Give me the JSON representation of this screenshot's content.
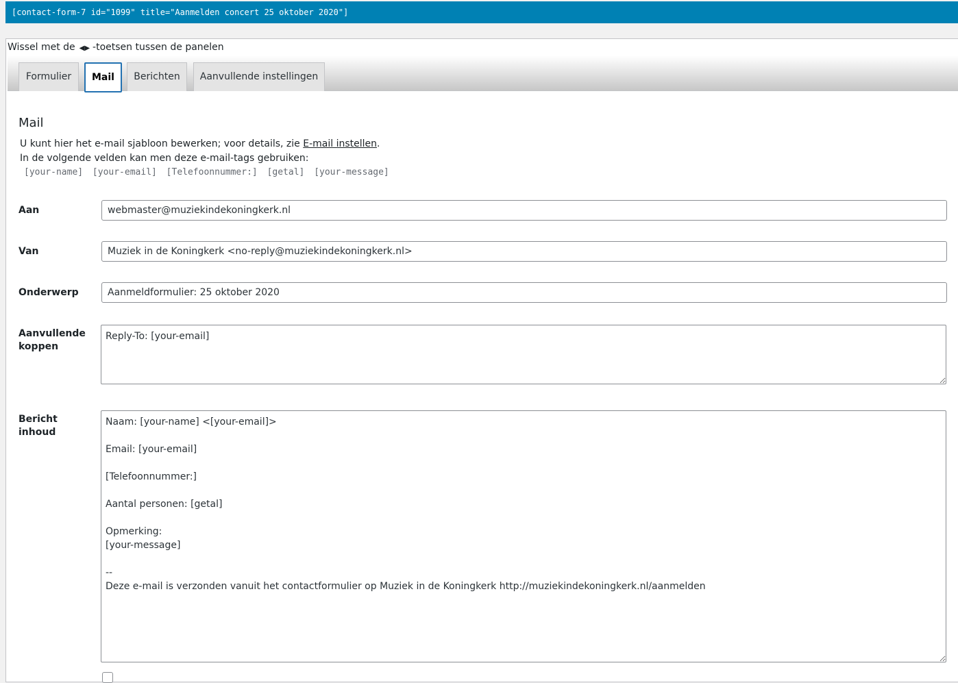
{
  "shortcode": "[contact-form-7 id=\"1099\" title=\"Aanmelden concert 25 oktober 2020\"]",
  "hint": {
    "prefix": "Wissel met de",
    "arrows": "◀▶",
    "suffix": "-toetsen tussen de panelen"
  },
  "tabs": [
    {
      "label": "Formulier"
    },
    {
      "label": "Mail",
      "active": true
    },
    {
      "label": "Berichten"
    },
    {
      "label": "Aanvullende instellingen"
    }
  ],
  "mail": {
    "title": "Mail",
    "desc_prefix": "U kunt hier het e-mail sjabloon bewerken; voor details, zie ",
    "desc_link": "E-mail instellen",
    "desc_suffix": ".",
    "tags_intro": "In de volgende velden kan men deze e-mail-tags gebruiken:",
    "tags": [
      "[your-name]",
      "[your-email]",
      "[Telefoonnummer:]",
      "[getal]",
      "[your-message]"
    ],
    "fields": {
      "to_label": "Aan",
      "to_value": "webmaster@muziekindekoningkerk.nl",
      "from_label": "Van",
      "from_value": "Muziek in de Koningkerk <no-reply@muziekindekoningkerk.nl>",
      "subject_label": "Onderwerp",
      "subject_value": "Aanmeldformulier: 25 oktober 2020",
      "headers_label_1": "Aanvullende",
      "headers_label_2": "koppen",
      "headers_value": "Reply-To: [your-email]",
      "body_label_1": "Bericht",
      "body_label_2": "inhoud",
      "body_value": "Naam: [your-name] <[your-email]>\n\nEmail: [your-email]\n\n[Telefoonnummer:]\n\nAantal personen: [getal]\n\nOpmerking:\n[your-message]\n\n--\nDeze e-mail is verzonden vanuit het contactformulier op Muziek in de Koningkerk http://muziekindekoningkerk.nl/aanmelden"
    }
  },
  "colors": {
    "shortcode_bg": "#0081b4",
    "active_tab_border": "#2271b1"
  }
}
